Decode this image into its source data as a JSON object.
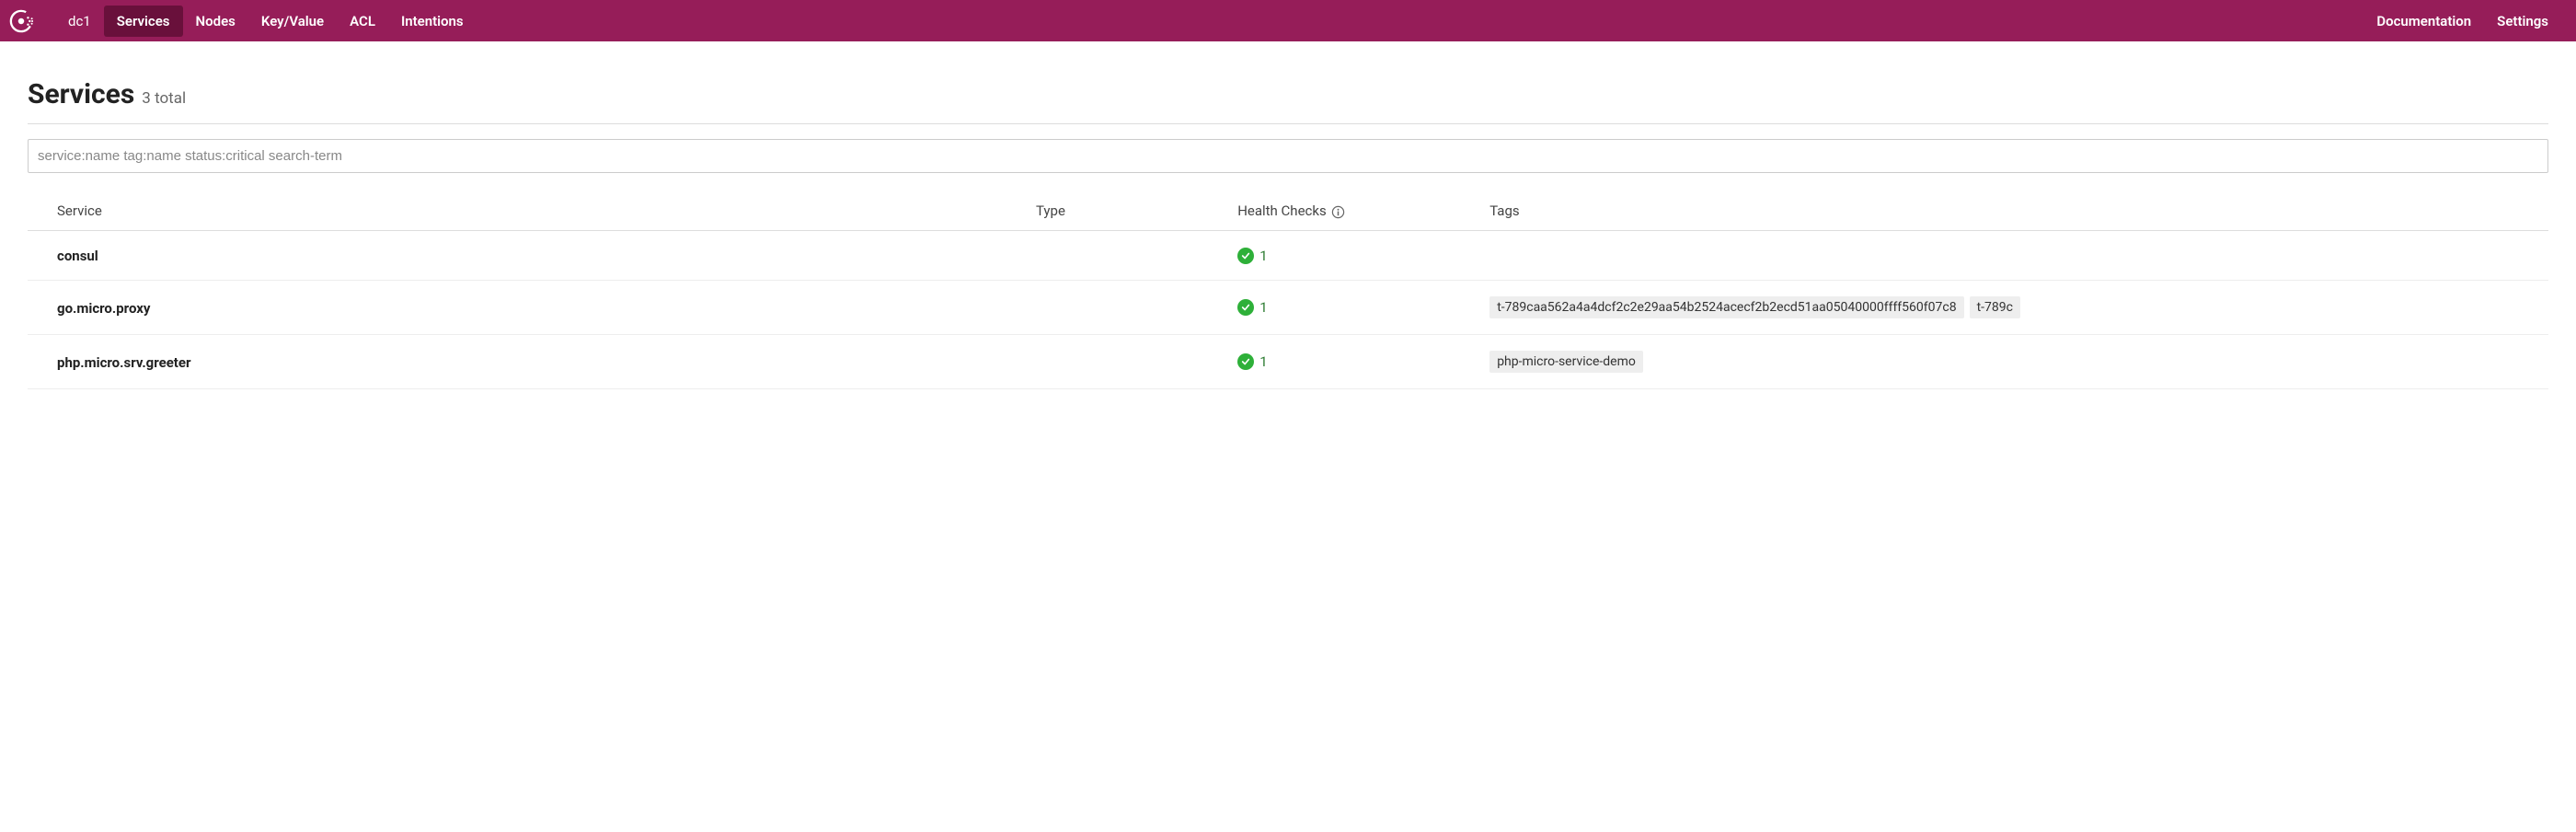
{
  "nav": {
    "datacenter": "dc1",
    "items": [
      {
        "label": "Services",
        "active": true
      },
      {
        "label": "Nodes",
        "active": false
      },
      {
        "label": "Key/Value",
        "active": false
      },
      {
        "label": "ACL",
        "active": false
      },
      {
        "label": "Intentions",
        "active": false
      }
    ],
    "right": [
      {
        "label": "Documentation"
      },
      {
        "label": "Settings"
      }
    ]
  },
  "page": {
    "title": "Services",
    "subtitle": "3 total"
  },
  "search": {
    "placeholder": "service:name tag:name status:critical search-term",
    "value": ""
  },
  "table": {
    "headers": {
      "service": "Service",
      "type": "Type",
      "health": "Health Checks",
      "tags": "Tags"
    },
    "rows": [
      {
        "name": "consul",
        "type": "",
        "health_passing": "1",
        "tags": []
      },
      {
        "name": "go.micro.proxy",
        "type": "",
        "health_passing": "1",
        "tags": [
          "t-789caa562a4a4dcf2c2e29aa54b2524acecf2b2ecd51aa05040000ffff560f07c8",
          "t-789c"
        ]
      },
      {
        "name": "php.micro.srv.greeter",
        "type": "",
        "health_passing": "1",
        "tags": [
          "php-micro-service-demo"
        ]
      }
    ]
  }
}
